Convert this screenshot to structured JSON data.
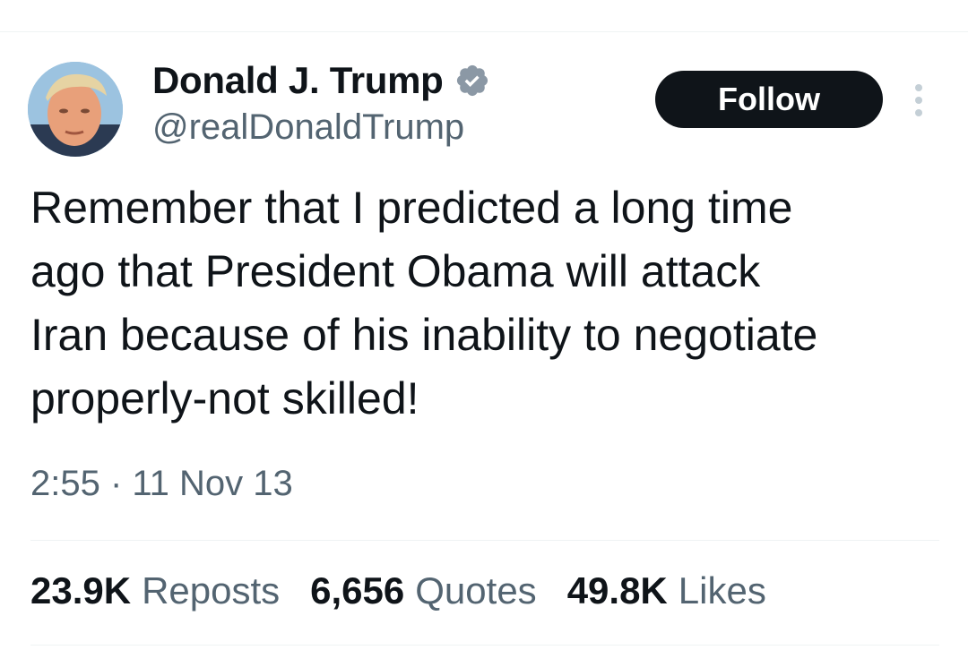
{
  "colors": {
    "text_primary": "#0f1419",
    "text_secondary": "#536471",
    "verified_badge": "#8b98a5",
    "follow_button_bg": "#0f1419",
    "follow_button_text": "#ffffff",
    "divider": "#eff3f4"
  },
  "author": {
    "display_name": "Donald J. Trump",
    "handle": "@realDonaldTrump",
    "verified": true,
    "avatar_icon": "profile-photo"
  },
  "actions": {
    "follow_label": "Follow",
    "more_icon": "more-vertical-icon"
  },
  "tweet": {
    "text": "Remember that I predicted a long time\nago that President Obama will attack\nIran because of his inability to negotiate\nproperly-not skilled!",
    "timestamp": "2:55 · 11 Nov 13"
  },
  "stats": {
    "reposts": {
      "count": "23.9K",
      "label": "Reposts"
    },
    "quotes": {
      "count": "6,656",
      "label": "Quotes"
    },
    "likes": {
      "count": "49.8K",
      "label": "Likes"
    }
  }
}
